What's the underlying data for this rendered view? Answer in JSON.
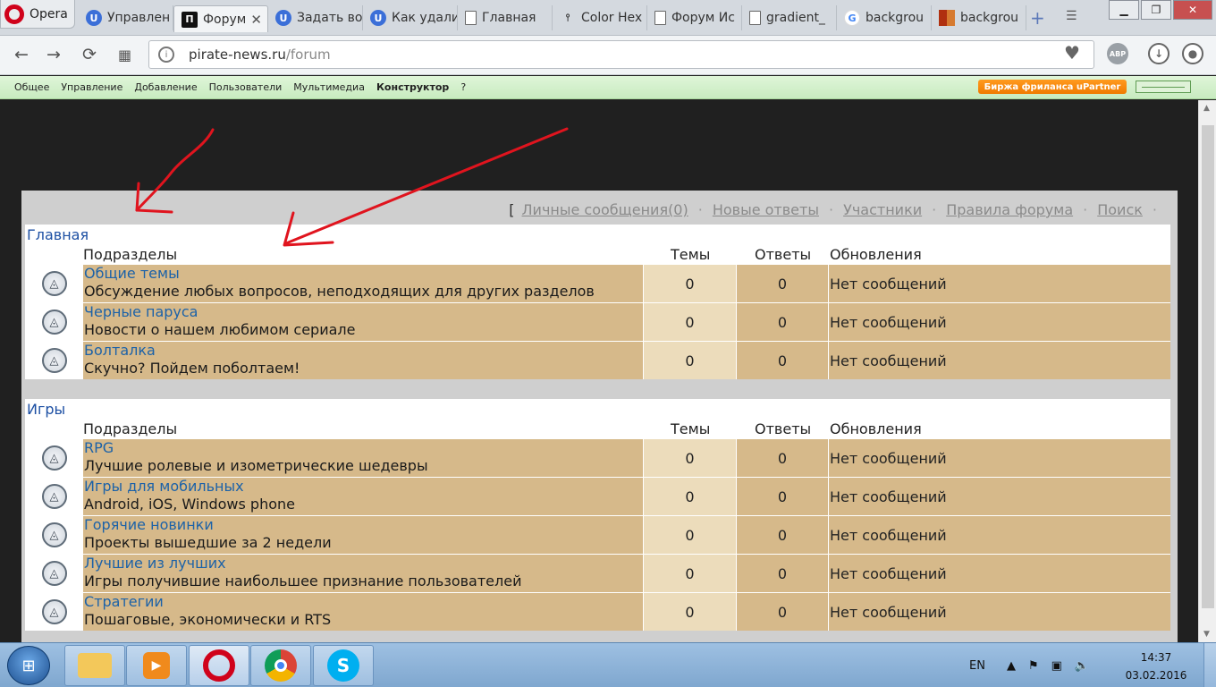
{
  "browser": {
    "app_name": "Opera",
    "tabs": [
      {
        "label": "Управлен",
        "icon": "ucoz-icon",
        "icon_glyph": "U",
        "active": false
      },
      {
        "label": "Форум",
        "icon": "forum-favicon",
        "icon_glyph": "П",
        "active": true
      },
      {
        "label": "Задать во",
        "icon": "ucoz-icon",
        "icon_glyph": "U",
        "active": false
      },
      {
        "label": "Как удали",
        "icon": "ucoz-icon",
        "icon_glyph": "U",
        "active": false
      },
      {
        "label": "Главная",
        "icon": "document-icon",
        "icon_glyph": "",
        "active": false
      },
      {
        "label": "Color Hex",
        "icon": "pin-icon",
        "icon_glyph": "⫯",
        "active": false
      },
      {
        "label": "Форум Ис",
        "icon": "page-icon",
        "icon_glyph": "",
        "active": false
      },
      {
        "label": "gradient_",
        "icon": "page-icon",
        "icon_glyph": "",
        "active": false
      },
      {
        "label": "backgrou",
        "icon": "google-icon",
        "icon_glyph": "G",
        "active": false
      },
      {
        "label": "backgrou",
        "icon": "mosaic-icon",
        "icon_glyph": "",
        "active": false
      }
    ],
    "url_host": "pirate-news.ru",
    "url_path": "/forum",
    "extensions": [
      "ABP"
    ]
  },
  "ucoz_panel": {
    "items": [
      "Общее",
      "Управление",
      "Добавление",
      "Пользователи",
      "Мультимедиа",
      "Конструктор",
      "?"
    ],
    "partner_label": "Биржа фриланса uPartner"
  },
  "forum": {
    "top_nav": {
      "bracket": "[",
      "links": [
        "Личные сообщения(0)",
        "Новые ответы",
        "Участники",
        "Правила форума",
        "Поиск"
      ],
      "separator": "·"
    },
    "columns": {
      "subsections": "Подразделы",
      "topics": "Темы",
      "replies": "Ответы",
      "updates": "Обновления"
    },
    "categories": [
      {
        "title": "Главная",
        "forums": [
          {
            "name": "Общие темы",
            "desc": "Обсуждение любых вопросов, неподходящих для других разделов",
            "topics": "0",
            "replies": "0",
            "updates": "Нет сообщений"
          },
          {
            "name": "Черные паруса",
            "desc": "Новости о нашем любимом сериале",
            "topics": "0",
            "replies": "0",
            "updates": "Нет сообщений"
          },
          {
            "name": "Болталка",
            "desc": "Скучно? Пойдем поболтаем!",
            "topics": "0",
            "replies": "0",
            "updates": "Нет сообщений"
          }
        ]
      },
      {
        "title": "Игры",
        "forums": [
          {
            "name": "RPG",
            "desc": "Лучшие ролевые и изометрические шедевры",
            "topics": "0",
            "replies": "0",
            "updates": "Нет сообщений"
          },
          {
            "name": "Игры для мобильных",
            "desc": "Android, iOS, Windows phone",
            "topics": "0",
            "replies": "0",
            "updates": "Нет сообщений"
          },
          {
            "name": "Горячие новинки",
            "desc": "Проекты вышедшие за 2 недели",
            "topics": "0",
            "replies": "0",
            "updates": "Нет сообщений"
          },
          {
            "name": "Лучшие из лучших",
            "desc": "Игры получившие наибольшее признание пользователей",
            "topics": "0",
            "replies": "0",
            "updates": "Нет сообщений"
          },
          {
            "name": "Стратегии",
            "desc": "Пошаговые, экономически и RTS",
            "topics": "0",
            "replies": "0",
            "updates": "Нет сообщений"
          }
        ]
      }
    ]
  },
  "taskbar": {
    "apps": [
      "file-explorer-icon",
      "media-player-icon",
      "opera-icon",
      "chrome-icon",
      "skype-icon"
    ],
    "language": "EN",
    "time": "14:37",
    "date": "03.02.2016"
  },
  "colors": {
    "page_bg": "#202020",
    "forum_row": "#d6b98a",
    "topics_cell": "#ecdcbb",
    "link": "#1c62a8",
    "annotation_arrow": "#e0141e"
  }
}
